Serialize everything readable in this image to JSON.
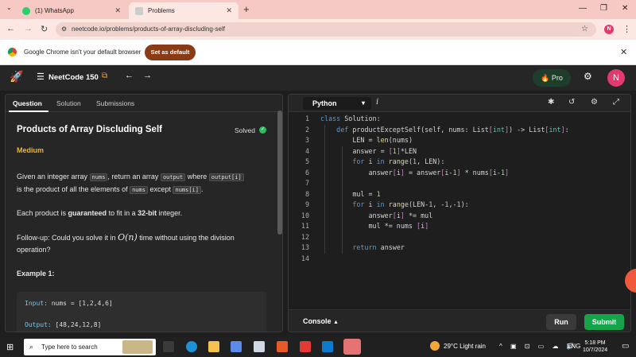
{
  "browser": {
    "tabs": [
      {
        "title": "(1) WhatsApp",
        "icon": "whatsapp-icon"
      },
      {
        "title": "Problems",
        "icon": "neetcode-icon"
      }
    ],
    "new_tab_label": "+",
    "url": "neetcode.io/problems/products-of-array-discluding-self",
    "profile_initial": "N",
    "infobar": {
      "message": "Google Chrome isn't your default browser",
      "button": "Set as default"
    }
  },
  "app": {
    "brand": "NeetCode 150",
    "pro_label": "Pro",
    "user_initial": "N"
  },
  "left": {
    "tabs": [
      "Question",
      "Solution",
      "Submissions"
    ],
    "active_tab": "Question",
    "title": "Products of Array Discluding Self",
    "status": "Solved",
    "difficulty": "Medium",
    "para1": {
      "t1": "Given an integer array ",
      "c1": "nums",
      "t2": ", return an array ",
      "c2": "output",
      "t3": " where ",
      "c3": "output[i]",
      "t4": "is the product of all the elements of ",
      "c4": "nums",
      "t5": " except ",
      "c5": "nums[i]",
      "t6": "."
    },
    "para2": {
      "t1": "Each product is ",
      "b1": "guaranteed",
      "t2": " to fit in a ",
      "b2": "32-bit",
      "t3": " integer."
    },
    "para3": {
      "t1": "Follow-up: Could you solve it in ",
      "math": "O(n)",
      "t2": " time without using the division",
      "t3": "operation?"
    },
    "example_heading": "Example 1:",
    "example": {
      "input_label": "Input:",
      "input_value": "nums = [1,2,4,6]",
      "output_label": "Output:",
      "output_value": "[48,24,12,8]"
    }
  },
  "editor": {
    "language": "Python",
    "info_icon": "i",
    "lines": [
      "class Solution:",
      "    def productExceptSelf(self, nums: List[int]) -> List[int]:",
      "        LEN = len(nums)",
      "        answer = [1]*LEN",
      "        for i in range(1, LEN):",
      "            answer[i] = answer[i-1] * nums[i-1]",
      "",
      "        mul = 1",
      "        for i in range(LEN-1, -1,-1):",
      "            answer[i] *= mul",
      "            mul *= nums [i]",
      "",
      "        return answer",
      ""
    ],
    "console_label": "Console",
    "run_label": "Run",
    "submit_label": "Submit"
  },
  "taskbar": {
    "search_placeholder": "Type here to search",
    "weather": "29°C  Light rain",
    "language": "ENG",
    "time": "5:18 PM",
    "date": "10/7/2024"
  },
  "colors": {
    "accent_green": "#16a34a",
    "medium": "#f0b429",
    "keyword": "#569cd6"
  }
}
